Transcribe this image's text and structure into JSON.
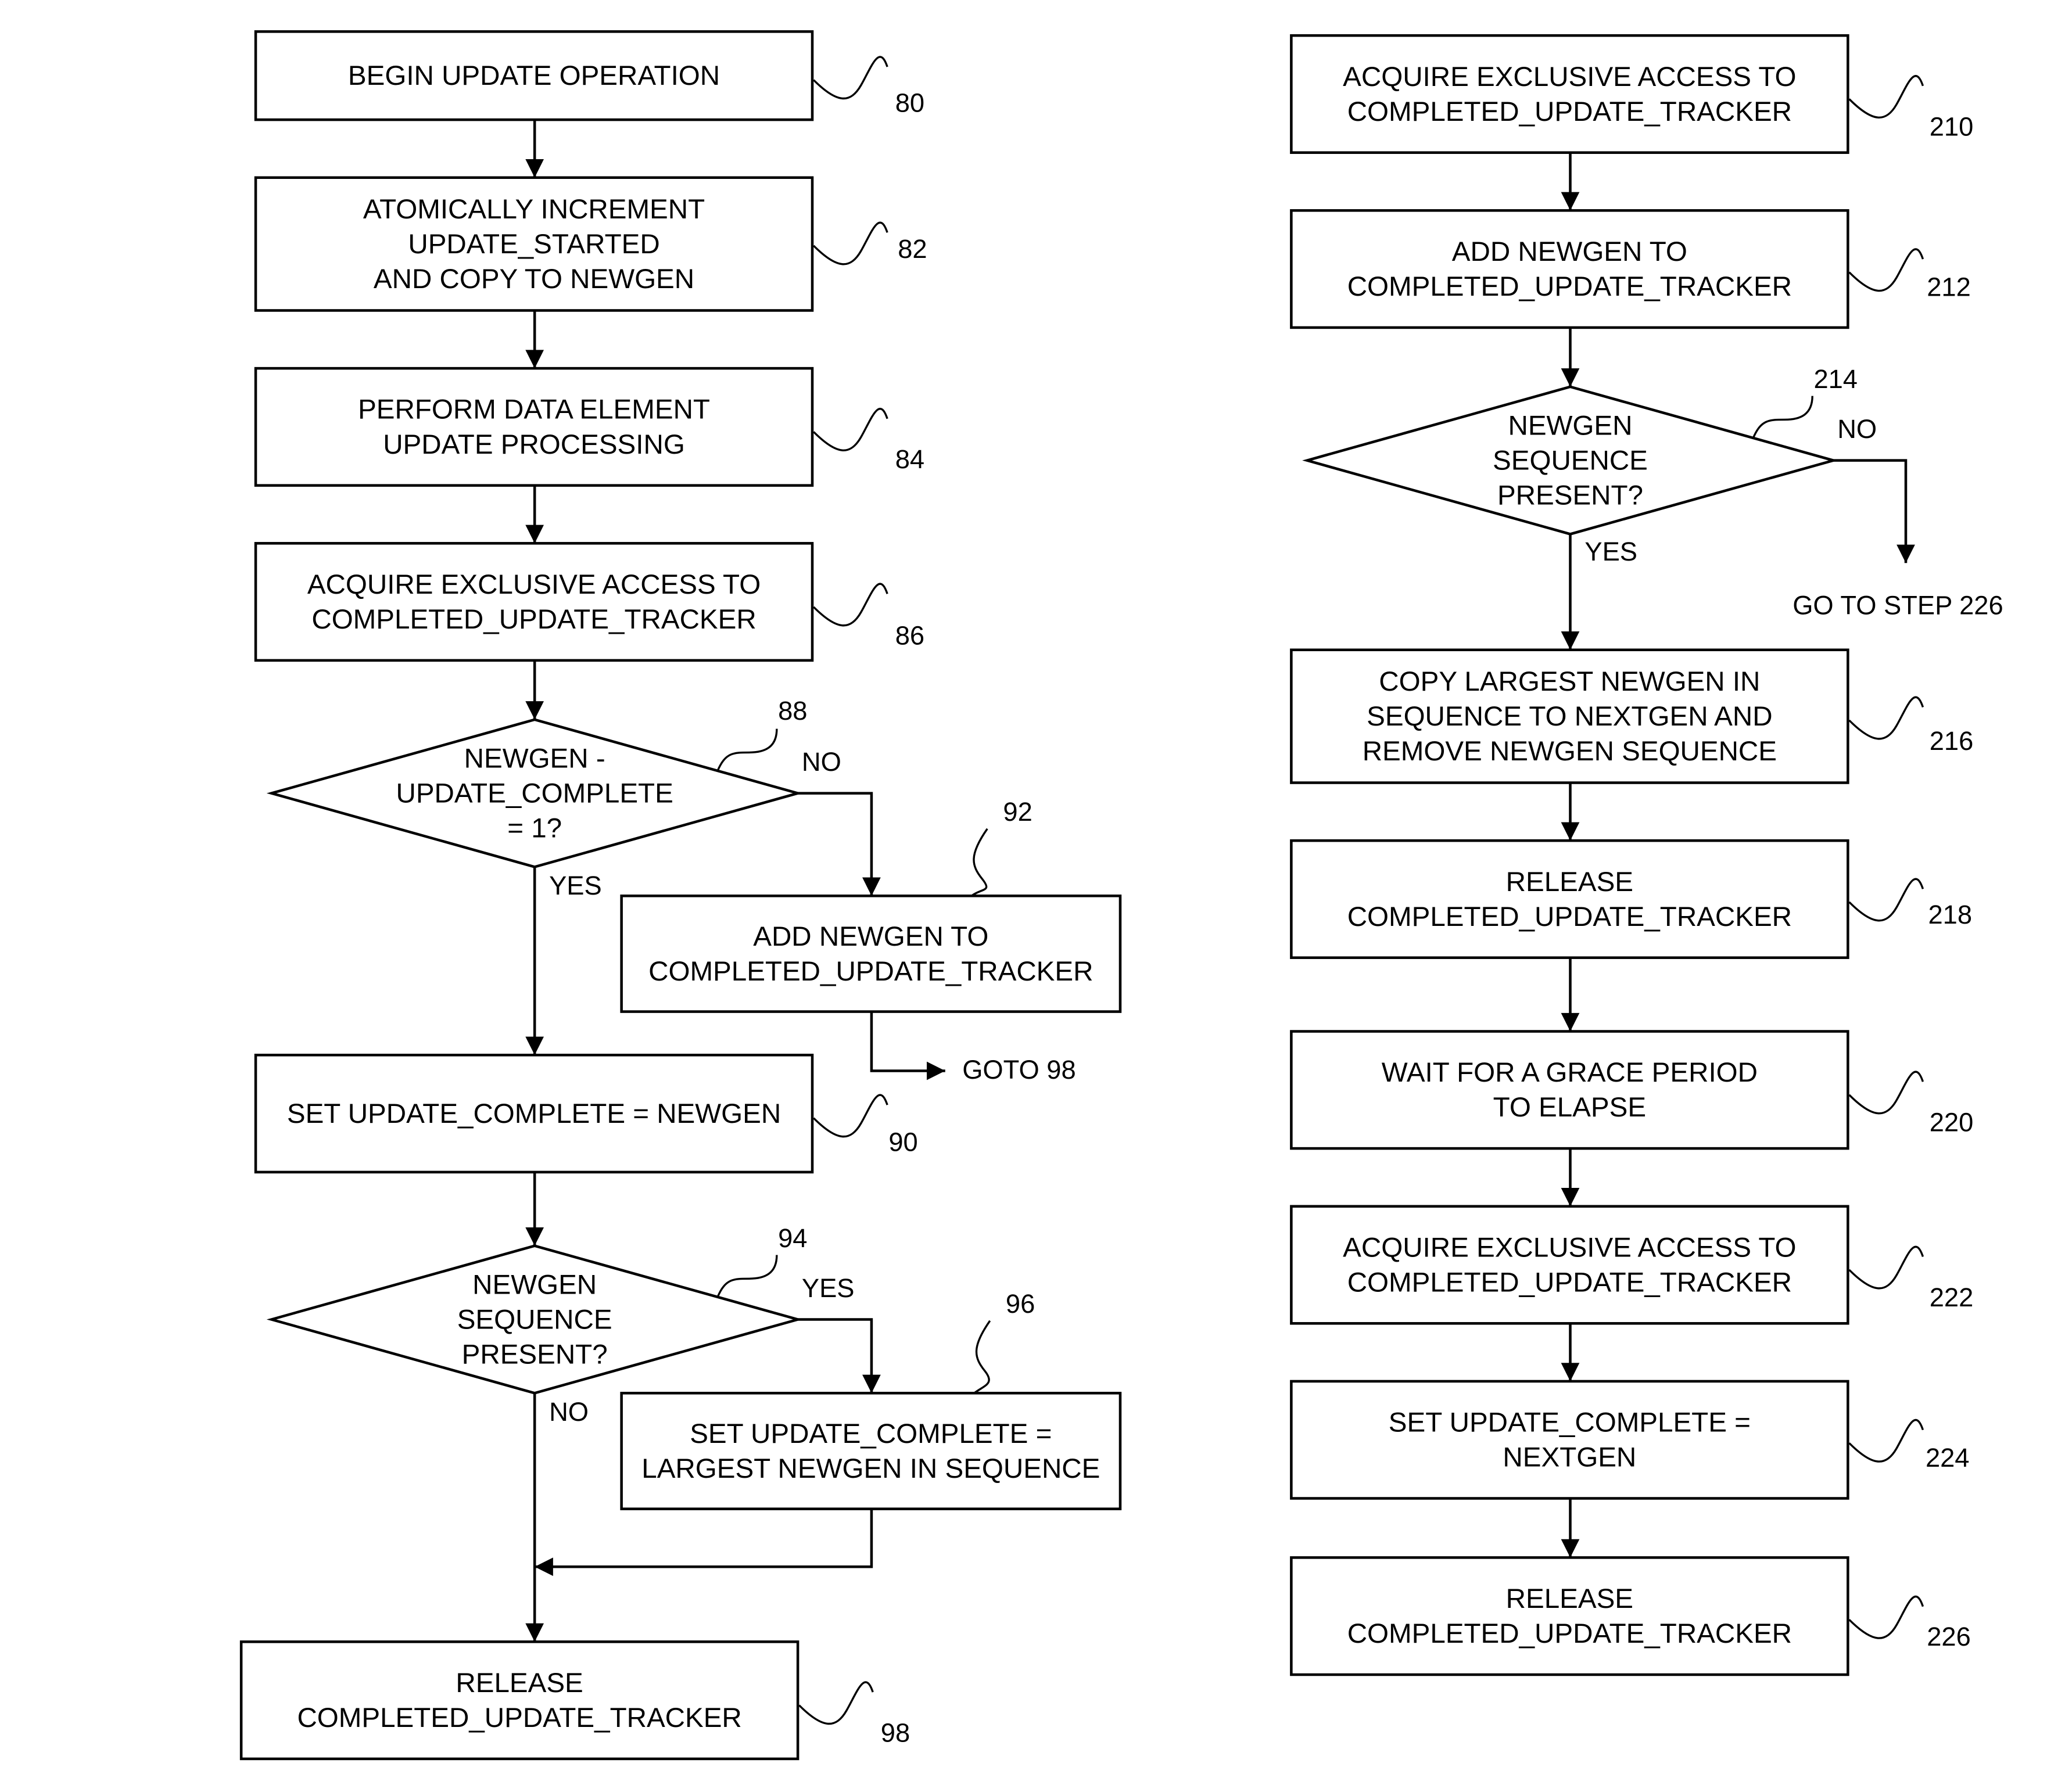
{
  "diagram": {
    "type": "flowchart",
    "flows": [
      {
        "name": "update-operation",
        "steps": [
          {
            "id": "80",
            "kind": "process",
            "lines": [
              "BEGIN UPDATE OPERATION"
            ]
          },
          {
            "id": "82",
            "kind": "process",
            "lines": [
              "ATOMICALLY INCREMENT",
              "UPDATE_STARTED",
              "AND COPY TO NEWGEN"
            ]
          },
          {
            "id": "84",
            "kind": "process",
            "lines": [
              "PERFORM DATA ELEMENT",
              "UPDATE PROCESSING"
            ]
          },
          {
            "id": "86",
            "kind": "process",
            "lines": [
              "ACQUIRE EXCLUSIVE ACCESS TO",
              "COMPLETED_UPDATE_TRACKER"
            ]
          },
          {
            "id": "88",
            "kind": "decision",
            "lines": [
              "NEWGEN -",
              "UPDATE_COMPLETE",
              "= 1?"
            ]
          },
          {
            "id": "92",
            "kind": "process",
            "lines": [
              "ADD NEWGEN TO",
              "COMPLETED_UPDATE_TRACKER"
            ]
          },
          {
            "id": "90",
            "kind": "process",
            "lines": [
              "SET UPDATE_COMPLETE = NEWGEN"
            ]
          },
          {
            "id": "94",
            "kind": "decision",
            "lines": [
              "NEWGEN",
              "SEQUENCE",
              "PRESENT?"
            ]
          },
          {
            "id": "96",
            "kind": "process",
            "lines": [
              "SET UPDATE_COMPLETE =",
              "LARGEST NEWGEN IN SEQUENCE"
            ]
          },
          {
            "id": "98",
            "kind": "process",
            "lines": [
              "RELEASE",
              "COMPLETED_UPDATE_TRACKER"
            ]
          }
        ],
        "edges": [
          {
            "from": "80",
            "to": "82",
            "label": ""
          },
          {
            "from": "82",
            "to": "84",
            "label": ""
          },
          {
            "from": "84",
            "to": "86",
            "label": ""
          },
          {
            "from": "86",
            "to": "88",
            "label": ""
          },
          {
            "from": "88",
            "to": "92",
            "label": "NO"
          },
          {
            "from": "88",
            "to": "90",
            "label": "YES"
          },
          {
            "from": "92",
            "to": "goto-98",
            "label": ""
          },
          {
            "from": "90",
            "to": "94",
            "label": ""
          },
          {
            "from": "94",
            "to": "96",
            "label": "YES"
          },
          {
            "from": "94",
            "to": "98",
            "label": "NO"
          },
          {
            "from": "96",
            "to": "98",
            "label": ""
          }
        ],
        "goto_label": "GOTO 98"
      },
      {
        "name": "grace-period-processing",
        "steps": [
          {
            "id": "210",
            "kind": "process",
            "lines": [
              "ACQUIRE EXCLUSIVE ACCESS TO",
              "COMPLETED_UPDATE_TRACKER"
            ]
          },
          {
            "id": "212",
            "kind": "process",
            "lines": [
              "ADD NEWGEN TO",
              "COMPLETED_UPDATE_TRACKER"
            ]
          },
          {
            "id": "214",
            "kind": "decision",
            "lines": [
              "NEWGEN",
              "SEQUENCE",
              "PRESENT?"
            ]
          },
          {
            "id": "216",
            "kind": "process",
            "lines": [
              "COPY LARGEST NEWGEN IN",
              "SEQUENCE TO NEXTGEN AND",
              "REMOVE NEWGEN SEQUENCE"
            ]
          },
          {
            "id": "218",
            "kind": "process",
            "lines": [
              "RELEASE",
              "COMPLETED_UPDATE_TRACKER"
            ]
          },
          {
            "id": "220",
            "kind": "process",
            "lines": [
              "WAIT FOR A GRACE PERIOD",
              "TO ELAPSE"
            ]
          },
          {
            "id": "222",
            "kind": "process",
            "lines": [
              "ACQUIRE EXCLUSIVE ACCESS TO",
              "COMPLETED_UPDATE_TRACKER"
            ]
          },
          {
            "id": "224",
            "kind": "process",
            "lines": [
              "SET UPDATE_COMPLETE =",
              "NEXTGEN"
            ]
          },
          {
            "id": "226",
            "kind": "process",
            "lines": [
              "RELEASE",
              "COMPLETED_UPDATE_TRACKER"
            ]
          }
        ],
        "edges": [
          {
            "from": "210",
            "to": "212",
            "label": ""
          },
          {
            "from": "212",
            "to": "214",
            "label": ""
          },
          {
            "from": "214",
            "to": "216",
            "label": "YES"
          },
          {
            "from": "214",
            "to": "goto-226",
            "label": "NO"
          },
          {
            "from": "216",
            "to": "218",
            "label": ""
          },
          {
            "from": "218",
            "to": "220",
            "label": ""
          },
          {
            "from": "220",
            "to": "222",
            "label": ""
          },
          {
            "from": "222",
            "to": "224",
            "label": ""
          },
          {
            "from": "224",
            "to": "226",
            "label": ""
          }
        ],
        "goto_label": "GO TO STEP 226"
      }
    ],
    "branch_labels": {
      "yes": "YES",
      "no": "NO"
    }
  }
}
